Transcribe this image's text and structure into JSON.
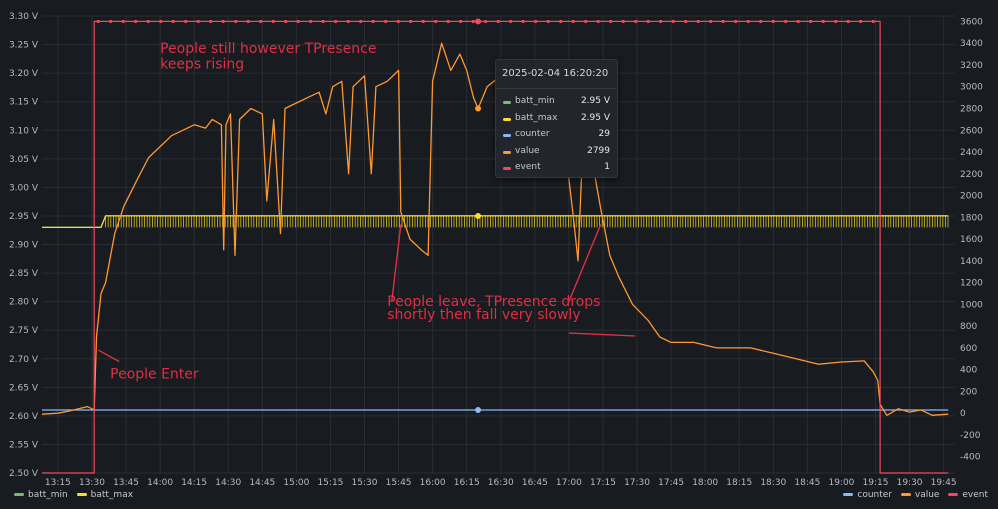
{
  "chart_data": {
    "type": "line",
    "title": "",
    "x_ticks": [
      "13:15",
      "13:30",
      "13:45",
      "14:00",
      "14:15",
      "14:30",
      "14:45",
      "15:00",
      "15:15",
      "15:30",
      "15:45",
      "16:00",
      "16:15",
      "16:30",
      "16:45",
      "17:00",
      "17:15",
      "17:30",
      "17:45",
      "18:00",
      "18:15",
      "18:30",
      "18:45",
      "19:00",
      "19:15",
      "19:30",
      "19:45"
    ],
    "xlim": [
      "13:08",
      "19:50"
    ],
    "y_left": {
      "range": [
        2.5,
        3.3
      ],
      "ticks": [
        "2.50 V",
        "2.55 V",
        "2.60 V",
        "2.65 V",
        "2.70 V",
        "2.75 V",
        "2.80 V",
        "2.85 V",
        "2.90 V",
        "2.95 V",
        "3.00 V",
        "3.05 V",
        "3.10 V",
        "3.15 V",
        "3.20 V",
        "3.25 V",
        "3.30 V"
      ]
    },
    "y_right": {
      "range": [
        -550,
        3650
      ],
      "ticks": [
        "-400",
        "-200",
        "0",
        "200",
        "400",
        "600",
        "800",
        "1000",
        "1200",
        "1400",
        "1600",
        "1800",
        "2000",
        "2200",
        "2400",
        "2600",
        "2800",
        "3000",
        "3200",
        "3400",
        "3600"
      ]
    },
    "grid": true,
    "legend_position": "bottom",
    "series": [
      {
        "name": "batt_min",
        "color": "#73bf69",
        "axis": "left",
        "points": [
          [
            "13:08",
            2.93
          ],
          [
            "13:34",
            2.93
          ],
          [
            "13:36",
            2.95
          ],
          [
            "19:47",
            2.95
          ]
        ]
      },
      {
        "name": "batt_max",
        "color": "#fade2a",
        "axis": "left",
        "points": [
          [
            "13:08",
            2.93
          ],
          [
            "13:34",
            2.93
          ],
          [
            "13:36",
            2.95
          ],
          [
            "19:47",
            2.95
          ]
        ],
        "note_dips_to": 2.93
      },
      {
        "name": "counter",
        "color": "#8ab8ff",
        "axis": "right",
        "points": [
          [
            "13:08",
            29
          ],
          [
            "19:47",
            29
          ]
        ]
      },
      {
        "name": "value",
        "color": "#ff9830",
        "axis": "right",
        "points": [
          [
            "13:08",
            -10
          ],
          [
            "13:15",
            0
          ],
          [
            "13:20",
            20
          ],
          [
            "13:28",
            60
          ],
          [
            "13:31",
            30
          ],
          [
            "13:32",
            700
          ],
          [
            "13:34",
            1100
          ],
          [
            "13:36",
            1200
          ],
          [
            "13:40",
            1650
          ],
          [
            "13:44",
            1900
          ],
          [
            "13:50",
            2150
          ],
          [
            "13:55",
            2350
          ],
          [
            "14:00",
            2450
          ],
          [
            "14:05",
            2550
          ],
          [
            "14:10",
            2600
          ],
          [
            "14:15",
            2650
          ],
          [
            "14:20",
            2620
          ],
          [
            "14:23",
            2700
          ],
          [
            "14:27",
            2650
          ],
          [
            "14:28",
            1500
          ],
          [
            "14:29",
            2650
          ],
          [
            "14:31",
            2750
          ],
          [
            "14:33",
            1450
          ],
          [
            "14:35",
            2700
          ],
          [
            "14:40",
            2800
          ],
          [
            "14:45",
            2750
          ],
          [
            "14:47",
            1950
          ],
          [
            "14:50",
            2700
          ],
          [
            "14:53",
            1650
          ],
          [
            "14:55",
            2800
          ],
          [
            "15:00",
            2850
          ],
          [
            "15:05",
            2900
          ],
          [
            "15:10",
            2950
          ],
          [
            "15:13",
            2750
          ],
          [
            "15:16",
            3000
          ],
          [
            "15:20",
            3050
          ],
          [
            "15:23",
            2200
          ],
          [
            "15:25",
            3000
          ],
          [
            "15:30",
            3100
          ],
          [
            "15:33",
            2200
          ],
          [
            "15:35",
            3000
          ],
          [
            "15:40",
            3050
          ],
          [
            "15:45",
            3150
          ],
          [
            "15:46",
            1850
          ],
          [
            "15:50",
            1600
          ],
          [
            "15:55",
            1500
          ],
          [
            "15:58",
            1450
          ],
          [
            "16:00",
            3050
          ],
          [
            "16:04",
            3400
          ],
          [
            "16:08",
            3150
          ],
          [
            "16:12",
            3300
          ],
          [
            "16:15",
            3150
          ],
          [
            "16:18",
            2900
          ],
          [
            "16:20",
            2800
          ],
          [
            "16:24",
            3000
          ],
          [
            "16:30",
            3100
          ],
          [
            "16:40",
            3150
          ],
          [
            "16:50",
            3200
          ],
          [
            "16:58",
            3100
          ],
          [
            "17:00",
            2150
          ],
          [
            "17:02",
            1800
          ],
          [
            "17:04",
            1400
          ],
          [
            "17:06",
            2400
          ],
          [
            "17:10",
            2350
          ],
          [
            "17:14",
            1880
          ],
          [
            "17:18",
            1450
          ],
          [
            "17:22",
            1250
          ],
          [
            "17:28",
            1000
          ],
          [
            "17:35",
            850
          ],
          [
            "17:40",
            700
          ],
          [
            "17:45",
            650
          ],
          [
            "17:55",
            650
          ],
          [
            "18:05",
            600
          ],
          [
            "18:20",
            600
          ],
          [
            "18:30",
            550
          ],
          [
            "18:40",
            500
          ],
          [
            "18:50",
            450
          ],
          [
            "19:00",
            470
          ],
          [
            "19:10",
            480
          ],
          [
            "19:14",
            380
          ],
          [
            "19:16",
            300
          ],
          [
            "19:17",
            80
          ],
          [
            "19:20",
            -20
          ],
          [
            "19:25",
            40
          ],
          [
            "19:30",
            10
          ],
          [
            "19:35",
            30
          ],
          [
            "19:40",
            -20
          ],
          [
            "19:47",
            -10
          ]
        ]
      },
      {
        "name": "event",
        "color": "#f2495c",
        "axis": "right",
        "points": [
          [
            "13:08",
            -550
          ],
          [
            "13:31",
            -550
          ],
          [
            "13:31",
            3600
          ],
          [
            "19:17",
            3600
          ],
          [
            "19:17",
            -550
          ],
          [
            "19:47",
            -550
          ]
        ]
      }
    ],
    "annotations": [
      {
        "text": "People still however TPresence",
        "at": [
          "14:00",
          3.235
        ]
      },
      {
        "text": "keeps rising",
        "at": [
          "14:00",
          3.208
        ]
      },
      {
        "text": "People Enter",
        "at": [
          "13:38",
          2.665
        ]
      },
      {
        "text": "People leave, TPresence drops",
        "at": [
          "15:40",
          2.792
        ]
      },
      {
        "text": "shortly then fall very slowly",
        "at": [
          "15:40",
          2.77
        ]
      }
    ],
    "tooltip": {
      "time": "2025-02-04 16:20:20",
      "rows": [
        {
          "name": "batt_min",
          "value": "2.95 V",
          "color": "#73bf69"
        },
        {
          "name": "batt_max",
          "value": "2.95 V",
          "color": "#fade2a"
        },
        {
          "name": "counter",
          "value": "29",
          "color": "#8ab8ff"
        },
        {
          "name": "value",
          "value": "2799",
          "color": "#ff9830"
        },
        {
          "name": "event",
          "value": "1",
          "color": "#f2495c"
        }
      ]
    }
  },
  "legend": {
    "left": [
      {
        "label": "batt_min",
        "color": "#73bf69"
      },
      {
        "label": "batt_max",
        "color": "#fade2a"
      }
    ],
    "right": [
      {
        "label": "counter",
        "color": "#8ab8ff"
      },
      {
        "label": "value",
        "color": "#ff9830"
      },
      {
        "label": "event",
        "color": "#f2495c"
      }
    ]
  }
}
